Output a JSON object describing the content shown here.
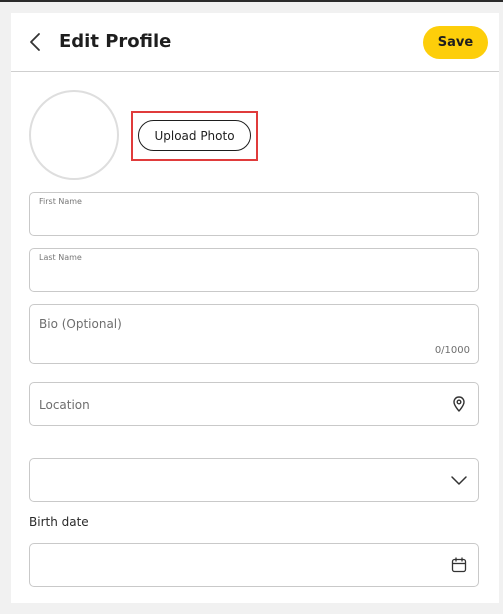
{
  "header": {
    "title": "Edit Profile",
    "save_label": "Save"
  },
  "photo": {
    "upload_label": "Upload Photo"
  },
  "form": {
    "first_name": {
      "label": "First Name",
      "value": ""
    },
    "last_name": {
      "label": "Last Name",
      "value": ""
    },
    "bio": {
      "placeholder": "Bio (Optional)",
      "counter": "0/1000"
    },
    "location": {
      "placeholder": "Location"
    },
    "select": {
      "value": ""
    },
    "birth_date": {
      "label": "Birth date",
      "value": ""
    }
  },
  "icons": {
    "back": "chevron-left-icon",
    "location": "map-pin-icon",
    "select": "chevron-down-icon",
    "calendar": "calendar-icon"
  },
  "colors": {
    "accent": "#fdce0a",
    "highlight": "#e03b3b"
  }
}
